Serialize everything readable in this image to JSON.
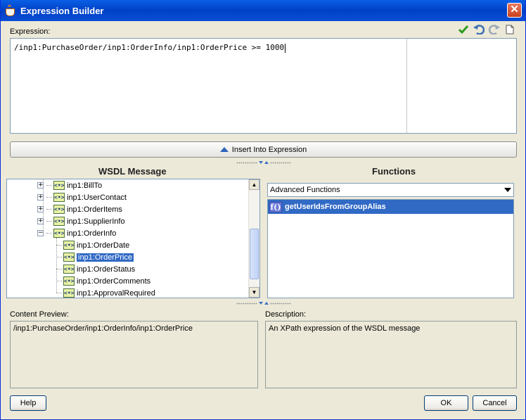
{
  "window": {
    "title": "Expression Builder",
    "close_glyph": "✕"
  },
  "expression": {
    "label": "Expression:",
    "value": "/inp1:PurchaseOrder/inp1:OrderInfo/inp1:OrderPrice >= 1000"
  },
  "toolbar": {
    "icons": [
      "check-icon",
      "undo-icon",
      "redo-icon",
      "new-document-icon"
    ]
  },
  "insert_button": {
    "label": "Insert Into Expression"
  },
  "wsdl": {
    "title": "WSDL Message",
    "tree": [
      {
        "label": "inp1:BillTo",
        "expander": "+",
        "level": 0,
        "selected": false
      },
      {
        "label": "inp1:UserContact",
        "expander": "+",
        "level": 0,
        "selected": false
      },
      {
        "label": "inp1:OrderItems",
        "expander": "+",
        "level": 0,
        "selected": false
      },
      {
        "label": "inp1:SupplierInfo",
        "expander": "+",
        "level": 0,
        "selected": false
      },
      {
        "label": "inp1:OrderInfo",
        "expander": "−",
        "level": 0,
        "selected": false
      },
      {
        "label": "inp1:OrderDate",
        "expander": "",
        "level": 1,
        "selected": false
      },
      {
        "label": "inp1:OrderPrice",
        "expander": "",
        "level": 1,
        "selected": true
      },
      {
        "label": "inp1:OrderStatus",
        "expander": "",
        "level": 1,
        "selected": false
      },
      {
        "label": "inp1:OrderComments",
        "expander": "",
        "level": 1,
        "selected": false
      },
      {
        "label": "inp1:ApprovalRequired",
        "expander": "",
        "level": 1,
        "selected": false
      }
    ],
    "node_icon_text": "<•>"
  },
  "functions": {
    "title": "Functions",
    "category_selected": "Advanced Functions",
    "items": [
      {
        "label": "getUserIdsFromGroupAlias",
        "icon_text": "f()"
      }
    ]
  },
  "content_preview": {
    "label": "Content Preview:",
    "value": "/inp1:PurchaseOrder/inp1:OrderInfo/inp1:OrderPrice"
  },
  "description": {
    "label": "Description:",
    "value": "An XPath expression of the WSDL message"
  },
  "buttons": {
    "help": "Help",
    "ok": "OK",
    "cancel": "Cancel"
  },
  "colors": {
    "selection": "#316ac5",
    "titlebar": "#0a5fe6",
    "dialog_bg": "#ece9d8"
  }
}
